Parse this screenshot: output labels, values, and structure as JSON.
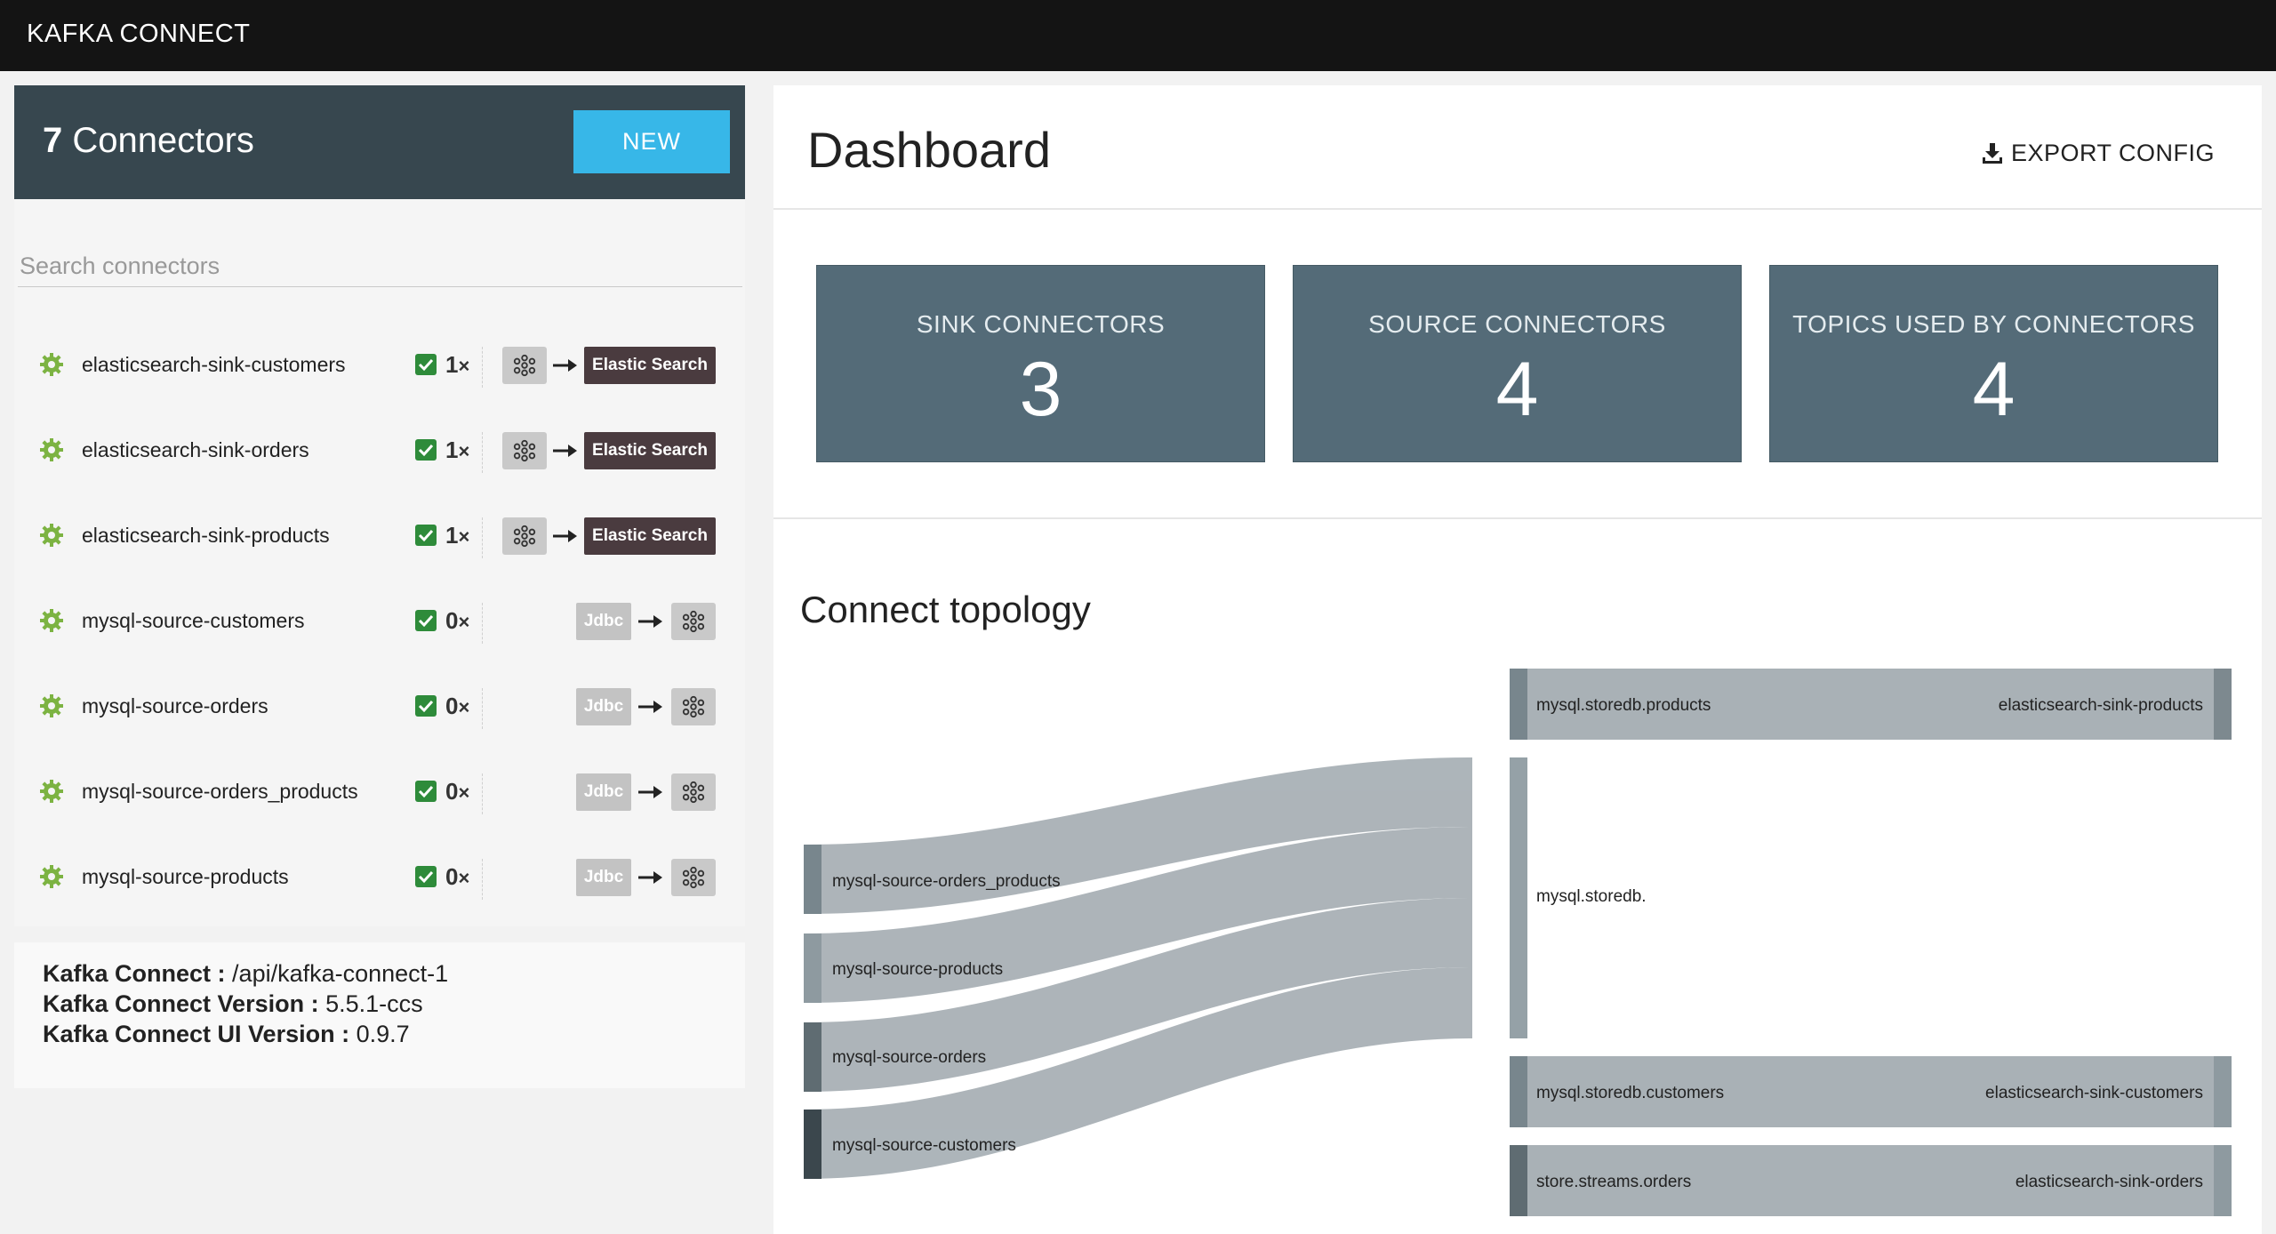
{
  "app": {
    "title": "KAFKA CONNECT"
  },
  "sidebar": {
    "count": "7",
    "count_suffix": " Connectors",
    "new_label": "NEW",
    "search_placeholder": "Search connectors",
    "connectors": [
      {
        "name": "elasticsearch-sink-customers",
        "tasks": "1",
        "kind": "sink",
        "badge": "Elastic Search"
      },
      {
        "name": "elasticsearch-sink-orders",
        "tasks": "1",
        "kind": "sink",
        "badge": "Elastic Search"
      },
      {
        "name": "elasticsearch-sink-products",
        "tasks": "1",
        "kind": "sink",
        "badge": "Elastic Search"
      },
      {
        "name": "mysql-source-customers",
        "tasks": "0",
        "kind": "source",
        "badge": "Jdbc"
      },
      {
        "name": "mysql-source-orders",
        "tasks": "0",
        "kind": "source",
        "badge": "Jdbc"
      },
      {
        "name": "mysql-source-orders_products",
        "tasks": "0",
        "kind": "source",
        "badge": "Jdbc"
      },
      {
        "name": "mysql-source-products",
        "tasks": "0",
        "kind": "source",
        "badge": "Jdbc"
      }
    ],
    "tasks_suffix": "×"
  },
  "info": {
    "connect_label": "Kafka Connect : ",
    "connect_value": " /api/kafka-connect-1",
    "version_label": "Kafka Connect Version : ",
    "version_value": "5.5.1-ccs",
    "ui_version_label": "Kafka Connect UI Version : ",
    "ui_version_value": "0.9.7"
  },
  "dashboard": {
    "title": "Dashboard",
    "export_label": "EXPORT CONFIG",
    "stats": [
      {
        "label": "SINK CONNECTORS",
        "value": "3"
      },
      {
        "label": "SOURCE CONNECTORS",
        "value": "4"
      },
      {
        "label": "TOPICS USED BY CONNECTORS",
        "value": "4"
      }
    ],
    "topology_title": "Connect topology"
  },
  "topology": {
    "sources": [
      "mysql-source-orders_products",
      "mysql-source-products",
      "mysql-source-orders",
      "mysql-source-customers"
    ],
    "hub": "mysql.storedb.",
    "topics": [
      {
        "topic": "mysql.storedb.products",
        "sink": "elasticsearch-sink-products"
      },
      {
        "topic": "mysql.storedb.customers",
        "sink": "elasticsearch-sink-customers"
      },
      {
        "topic": "store.streams.orders",
        "sink": "elasticsearch-sink-orders"
      }
    ]
  },
  "colors": {
    "topbar": "#141414",
    "header": "#37474f",
    "new_button": "#37b7e8",
    "stat_card": "#546b78",
    "es_badge": "#4a3b3f",
    "check": "#2e8b3a",
    "gear": "#7cb342",
    "flow": "#a9b1b6"
  }
}
